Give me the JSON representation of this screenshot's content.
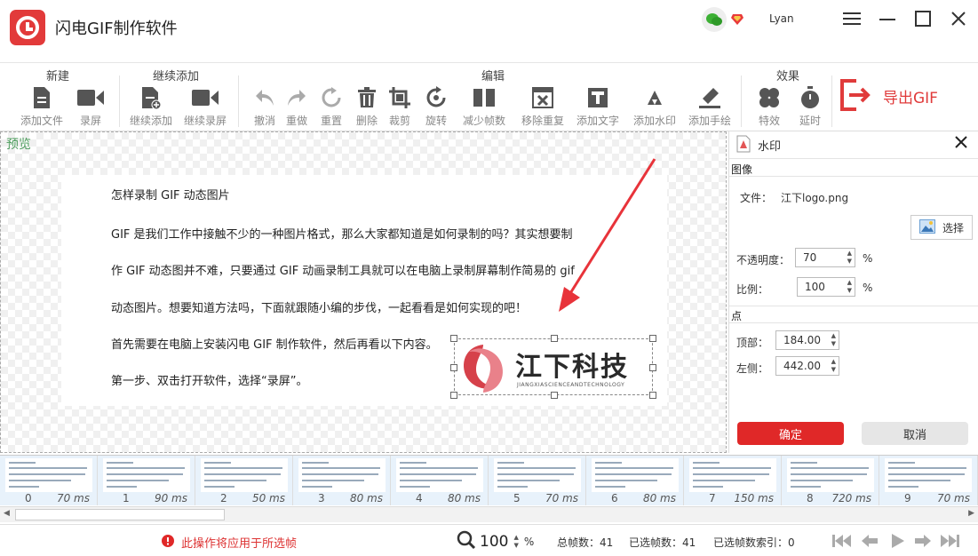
{
  "app": {
    "title": "闪电GIF制作软件",
    "username": "Lyan"
  },
  "toolbar": {
    "groups": {
      "new": "新建",
      "continue": "继续添加",
      "edit": "编辑",
      "effects": "效果"
    },
    "tools": {
      "add_file": "添加文件",
      "record": "录屏",
      "continue_add": "继续添加",
      "continue_record": "继续录屏",
      "undo": "撤消",
      "redo": "重做",
      "reset": "重置",
      "delete": "删除",
      "crop": "裁剪",
      "rotate": "旋转",
      "reduce_frames": "减少帧数",
      "remove_duplicates": "移除重复",
      "add_text": "添加文字",
      "add_watermark": "添加水印",
      "add_drawing": "添加手绘",
      "effects": "特效",
      "delay": "延时"
    },
    "export_label": "导出GIF"
  },
  "preview": {
    "label": "预览",
    "lines": [
      "怎样录制 GIF 动态图片",
      "GIF 是我们工作中接触不少的一种图片格式，那么大家都知道是如何录制的吗？其实想要制",
      "作 GIF 动态图并不难，只要通过 GIF 动画录制工具就可以在电脑上录制屏幕制作简易的 gif",
      "动态图片。想要知道方法吗，下面就跟随小编的步伐，一起看看是如何实现的吧！",
      "首先需要在电脑上安装闪电 GIF 制作软件，然后再看以下内容。",
      "第一步、双击打开软件，选择“录屏”。"
    ],
    "watermark": {
      "text": "江下科技",
      "sub": "JIANGXIASCIENCEANDTECHNOLOGY"
    }
  },
  "panel": {
    "title": "水印",
    "image_section": "图像",
    "file_label": "文件：",
    "file_value": "江下logo.png",
    "choose_label": "选择",
    "opacity_label": "不透明度：",
    "opacity_value": "70",
    "scale_label": "比例：",
    "scale_value": "100",
    "percent": "%",
    "point_section": "点",
    "top_label": "顶部：",
    "top_value": "184.00",
    "left_label": "左侧：",
    "left_value": "442.00",
    "ok_label": "确定",
    "cancel_label": "取消"
  },
  "frames": [
    {
      "index": "0",
      "ms": "70 ms"
    },
    {
      "index": "1",
      "ms": "90 ms"
    },
    {
      "index": "2",
      "ms": "50 ms"
    },
    {
      "index": "3",
      "ms": "80 ms"
    },
    {
      "index": "4",
      "ms": "80 ms"
    },
    {
      "index": "5",
      "ms": "70 ms"
    },
    {
      "index": "6",
      "ms": "80 ms"
    },
    {
      "index": "7",
      "ms": "150 ms"
    },
    {
      "index": "8",
      "ms": "720 ms"
    },
    {
      "index": "9",
      "ms": "70 ms"
    }
  ],
  "status": {
    "warning": "此操作将应用于所选帧",
    "zoom": "100",
    "zoom_unit": "%",
    "total_frames": "总帧数：41",
    "selected_frames": "已选帧数：41",
    "selected_index": "已选帧数索引：0"
  },
  "colors": {
    "accent": "#e02828",
    "preview_label": "#4a9a5a",
    "frame_bg": "#e8f2fb"
  }
}
